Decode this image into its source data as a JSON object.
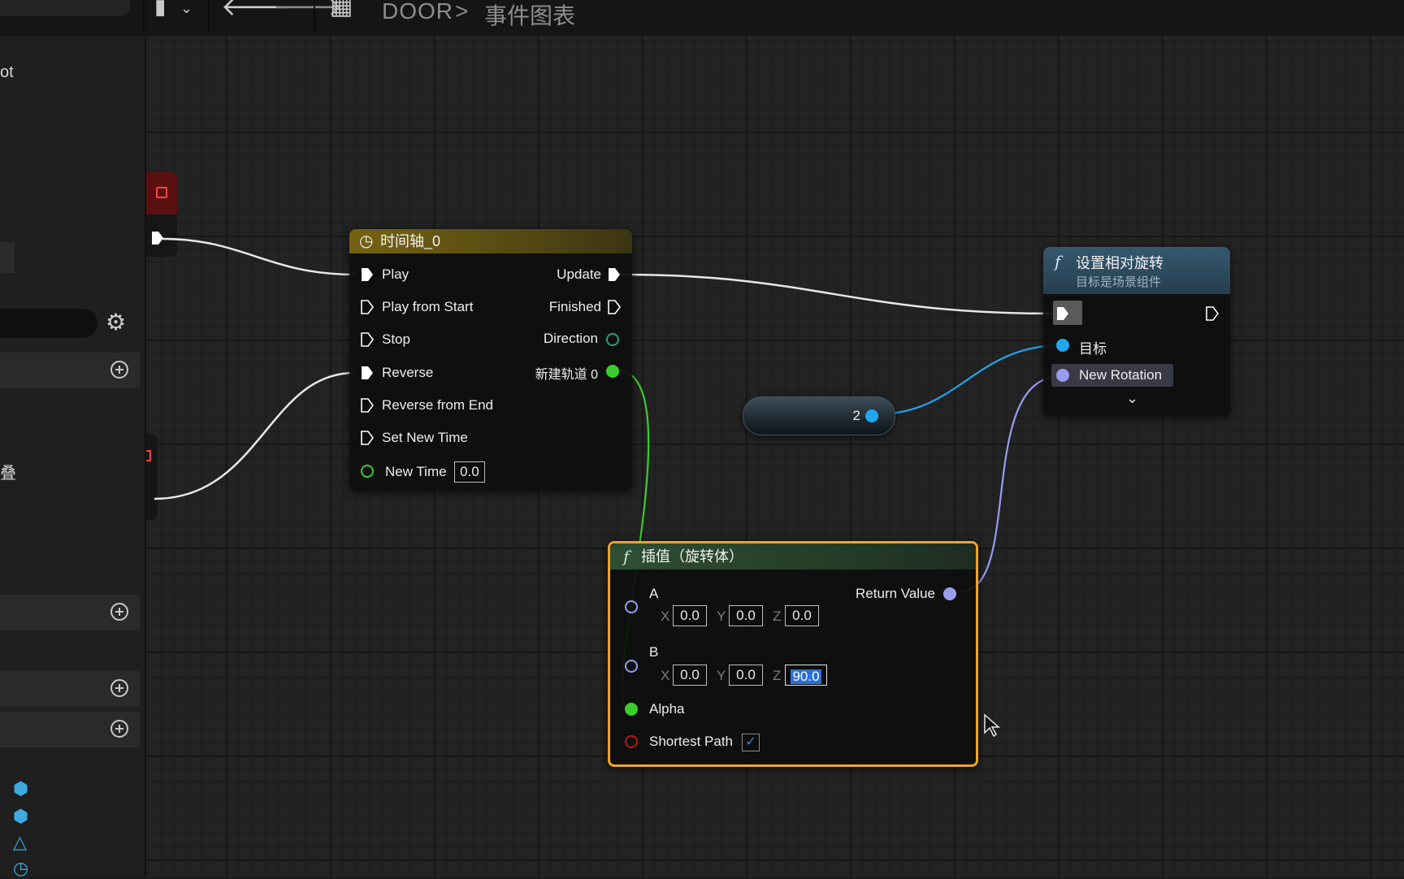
{
  "toolbar": {
    "breadcrumb_root": "DOOR",
    "breadcrumb_sep": ">",
    "breadcrumb_graph": "事件图表"
  },
  "left_panel": {
    "partial_text_1": "ot",
    "partial_text_2": "叠"
  },
  "timeline_node": {
    "title": "时间轴_0",
    "inputs": [
      {
        "label": "Play"
      },
      {
        "label": "Play from Start"
      },
      {
        "label": "Stop"
      },
      {
        "label": "Reverse"
      },
      {
        "label": "Reverse from End"
      },
      {
        "label": "Set New Time"
      }
    ],
    "new_time_label": "New Time",
    "new_time_value": "0.0",
    "outputs": [
      {
        "label": "Update"
      },
      {
        "label": "Finished"
      },
      {
        "label": "Direction"
      },
      {
        "label": "新建轨道 0"
      }
    ]
  },
  "set_rotation_node": {
    "title": "设置相对旋转",
    "subtitle": "目标是场景组件",
    "target_label": "目标",
    "new_rotation_label": "New Rotation"
  },
  "variable_node": {
    "label": "2"
  },
  "lerp_node": {
    "title": "插值（旋转体）",
    "a_label": "A",
    "a_x": "0.0",
    "a_y": "0.0",
    "a_z": "0.0",
    "b_label": "B",
    "b_x": "0.0",
    "b_y": "0.0",
    "b_z": "90.0",
    "alpha_label": "Alpha",
    "shortest_path_label": "Shortest Path",
    "shortest_path_checked": true,
    "return_value_label": "Return Value",
    "axis_x": "X",
    "axis_y": "Y",
    "axis_z": "Z"
  },
  "colors": {
    "exec": "#ffffff",
    "float_pin": "#3ccc2e",
    "object_pin": "#1fa6f0",
    "rotator_pin": "#9a9cf0",
    "bool_pin": "#b81818",
    "timeline_header": "#6b5a10",
    "function_header": "#2c4a5c",
    "lerp_header": "#27412c",
    "selection": "#f0a22a"
  }
}
